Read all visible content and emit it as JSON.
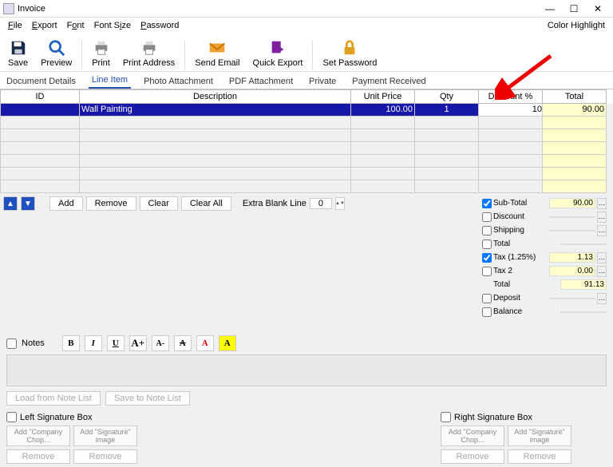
{
  "window": {
    "title": "Invoice",
    "min": "—",
    "max": "☐",
    "close": "✕"
  },
  "menu": {
    "file": "File",
    "export": "Export",
    "font": "Font",
    "fontsize": "Font Size",
    "password": "Password",
    "color": "Color Highlight"
  },
  "toolbar": {
    "save": "Save",
    "preview": "Preview",
    "print": "Print",
    "printAddr": "Print Address",
    "sendEmail": "Send Email",
    "quickExport": "Quick Export",
    "setPassword": "Set Password"
  },
  "tabs": {
    "doc": "Document Details",
    "line": "Line Item",
    "photo": "Photo Attachment",
    "pdf": "PDF Attachment",
    "private": "Private",
    "payment": "Payment Received"
  },
  "gridHead": {
    "id": "ID",
    "desc": "Description",
    "unit": "Unit Price",
    "qty": "Qty",
    "disc": "Discount %",
    "total": "Total"
  },
  "row1": {
    "id": "",
    "desc": "Wall Painting",
    "unit": "100.00",
    "qty": "1",
    "disc": "10",
    "total": "90.00"
  },
  "rowbtns": {
    "add": "Add",
    "remove": "Remove",
    "clear": "Clear",
    "clearAll": "Clear All",
    "extraBlank": "Extra Blank Line",
    "extraVal": "0"
  },
  "totals": {
    "subtotal": {
      "lbl": "Sub-Total",
      "val": "90.00"
    },
    "discount": {
      "lbl": "Discount",
      "val": ""
    },
    "shipping": {
      "lbl": "Shipping",
      "val": ""
    },
    "total1": {
      "lbl": "Total",
      "val": ""
    },
    "tax1": {
      "lbl": "Tax (1.25%)",
      "val": "1.13"
    },
    "tax2": {
      "lbl": "Tax 2",
      "val": "0.00"
    },
    "total2": {
      "lbl": "Total",
      "val": "91.13"
    },
    "deposit": {
      "lbl": "Deposit",
      "val": ""
    },
    "balance": {
      "lbl": "Balance",
      "val": ""
    }
  },
  "notes": {
    "check": "Notes"
  },
  "notebtns": {
    "load": "Load from Note List",
    "save": "Save to Note List"
  },
  "sig": {
    "left": "Left Signature Box",
    "right": "Right Signature Box",
    "chop": "Add \"Company Chop...",
    "sigimg": "Add \"Signature\" image",
    "remove": "Remove"
  }
}
